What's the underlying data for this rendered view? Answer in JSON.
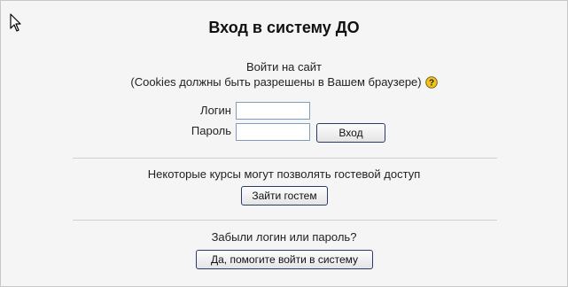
{
  "login_box": {
    "title": "Вход в систему ДО",
    "intro_line1": "Войти на сайт",
    "intro_line2": "(Cookies должны быть разрешены в Вашем браузере)",
    "username_label": "Логин",
    "username_value": "",
    "password_label": "Пароль",
    "password_value": "",
    "login_button": "Вход"
  },
  "guest_section": {
    "text": "Некоторые курсы могут позволять гостевой доступ",
    "button": "Зайти гостем"
  },
  "forgot_section": {
    "text": "Забыли логин или пароль?",
    "button": "Да, помогите войти в систему"
  },
  "icons": {
    "help": "help-icon",
    "cursor": "mouse-cursor-icon"
  },
  "colors": {
    "help_icon": "#f0c419",
    "button_border": "#2c3b66"
  }
}
